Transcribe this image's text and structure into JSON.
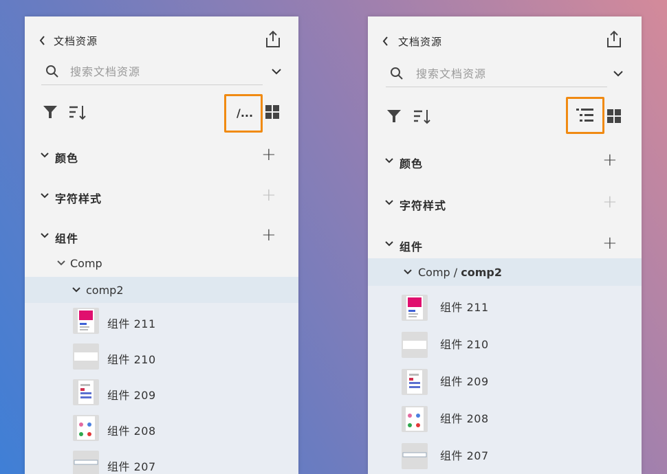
{
  "colors": {
    "accent_highlight": "#f08a12",
    "panel_bg": "#f3f3f3",
    "selected_row": "#dfe8f0",
    "list_bg": "#e9edf3"
  },
  "panel_title": "文档资源",
  "search_placeholder": "搜索文档资源",
  "icons": {
    "back": "chevron-left-icon",
    "share": "share-icon",
    "search": "search-icon",
    "dropdown": "chevron-down-icon",
    "filter": "filter-icon",
    "sort": "sort-icon",
    "path_view": "path-view-icon",
    "tree_view": "tree-view-icon",
    "grid_view": "grid-view-icon"
  },
  "left": {
    "path_view_label": "/...",
    "sections": [
      {
        "label": "颜色",
        "add_enabled": true
      },
      {
        "label": "字符样式",
        "add_enabled": false
      },
      {
        "label": "组件",
        "add_enabled": true
      }
    ],
    "folder": "Comp",
    "subfolder": "comp2",
    "items": [
      "组件 211",
      "组件 210",
      "组件 209",
      "组件 208",
      "组件 207"
    ]
  },
  "right": {
    "sections": [
      {
        "label": "颜色",
        "add_enabled": true
      },
      {
        "label": "字符样式",
        "add_enabled": false
      },
      {
        "label": "组件",
        "add_enabled": true
      }
    ],
    "path_prefix": "Comp / ",
    "path_current": "comp2",
    "items": [
      "组件 211",
      "组件 210",
      "组件 209",
      "组件 208",
      "组件 207"
    ]
  }
}
